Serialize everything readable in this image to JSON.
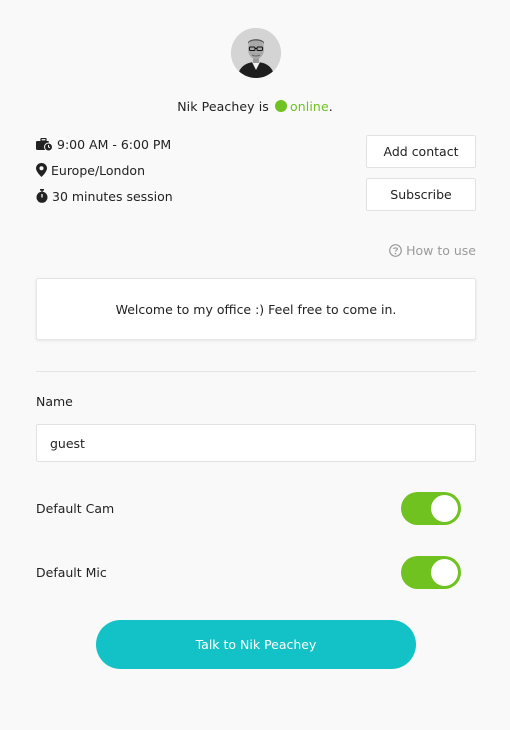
{
  "profile": {
    "name": "Nik Peachey",
    "status_prefix": "Nik Peachey is",
    "status": "online",
    "status_suffix": ".",
    "status_color": "#6fc21f"
  },
  "info": {
    "hours": "9:00 AM - 6:00 PM",
    "timezone": "Europe/London",
    "session": "30 minutes session",
    "hours_icon": "briefcase-clock-icon",
    "timezone_icon": "map-marker-icon",
    "session_icon": "stopwatch-icon"
  },
  "actions": {
    "add_contact": "Add contact",
    "subscribe": "Subscribe"
  },
  "help": {
    "how_to_use": "How to use",
    "icon": "question-circle-icon"
  },
  "welcome_message": "Welcome to my office :) Feel free to come in.",
  "form": {
    "name_label": "Name",
    "name_value": "guest",
    "cam_label": "Default Cam",
    "cam_enabled": true,
    "mic_label": "Default Mic",
    "mic_enabled": true
  },
  "talk_button": "Talk to Nik Peachey",
  "colors": {
    "accent": "#12c2c6",
    "toggle_on": "#6fc21f",
    "background": "#f9f9f9"
  }
}
